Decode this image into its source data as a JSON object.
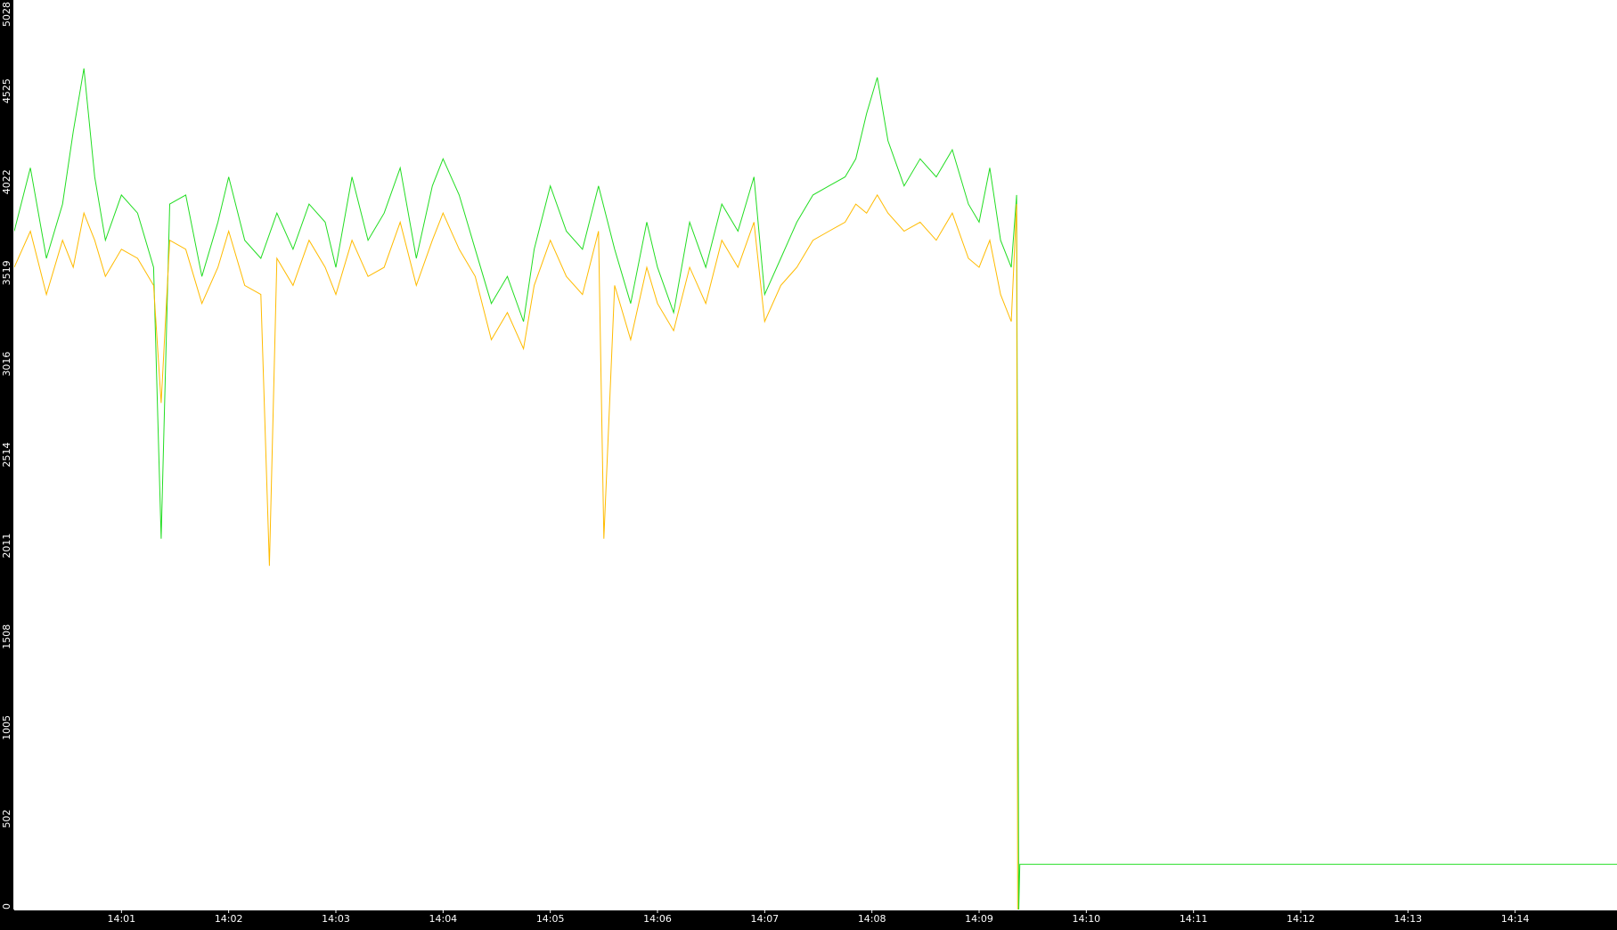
{
  "chart_data": {
    "type": "line",
    "title": "",
    "xlabel": "",
    "ylabel": "",
    "background_color": "#000000",
    "plot_background_color": "#ffffff",
    "axis_color": "#ffffff",
    "grid": false,
    "legend": "none",
    "ylim": [
      0,
      5028
    ],
    "y_ticks": [
      {
        "value": 0,
        "label": "0"
      },
      {
        "value": 502,
        "label": "502"
      },
      {
        "value": 1005,
        "label": "1005"
      },
      {
        "value": 1508,
        "label": "1508"
      },
      {
        "value": 2011,
        "label": "2011"
      },
      {
        "value": 2514,
        "label": "2514"
      },
      {
        "value": 3016,
        "label": "3016"
      },
      {
        "value": 3519,
        "label": "3519"
      },
      {
        "value": 4022,
        "label": "4022"
      },
      {
        "value": 4525,
        "label": "4525"
      },
      {
        "value": 5028,
        "label": "5028"
      }
    ],
    "x_unit": "minutes since 14:00",
    "xlim": [
      0.0,
      14.95
    ],
    "x_ticks": [
      {
        "value": 1,
        "label": "14:01"
      },
      {
        "value": 2,
        "label": "14:02"
      },
      {
        "value": 3,
        "label": "14:03"
      },
      {
        "value": 4,
        "label": "14:04"
      },
      {
        "value": 5,
        "label": "14:05"
      },
      {
        "value": 6,
        "label": "14:06"
      },
      {
        "value": 7,
        "label": "14:07"
      },
      {
        "value": 8,
        "label": "14:08"
      },
      {
        "value": 9,
        "label": "14:09"
      },
      {
        "value": 10,
        "label": "14:10"
      },
      {
        "value": 11,
        "label": "14:11"
      },
      {
        "value": 12,
        "label": "14:12"
      },
      {
        "value": 13,
        "label": "14:13"
      },
      {
        "value": 14,
        "label": "14:14"
      }
    ],
    "series": [
      {
        "color": "#22dd22",
        "x": [
          0.0,
          0.15,
          0.3,
          0.45,
          0.55,
          0.65,
          0.75,
          0.85,
          1.0,
          1.15,
          1.3,
          1.37,
          1.45,
          1.6,
          1.75,
          1.9,
          2.0,
          2.15,
          2.3,
          2.45,
          2.6,
          2.75,
          2.9,
          3.0,
          3.15,
          3.3,
          3.45,
          3.6,
          3.75,
          3.9,
          4.0,
          4.15,
          4.3,
          4.45,
          4.6,
          4.75,
          4.85,
          5.0,
          5.15,
          5.3,
          5.45,
          5.6,
          5.75,
          5.9,
          6.0,
          6.15,
          6.3,
          6.45,
          6.6,
          6.75,
          6.9,
          7.0,
          7.15,
          7.3,
          7.45,
          7.6,
          7.75,
          7.85,
          7.95,
          8.05,
          8.15,
          8.3,
          8.45,
          8.6,
          8.75,
          8.9,
          9.0,
          9.1,
          9.2,
          9.3,
          9.35,
          9.36,
          9.37,
          9.38,
          9.45,
          10.0,
          11.0,
          12.0,
          13.0,
          14.0,
          14.95
        ],
        "values": [
          3750,
          4100,
          3600,
          3900,
          4300,
          4650,
          4050,
          3700,
          3950,
          3850,
          3550,
          2050,
          3900,
          3950,
          3500,
          3800,
          4050,
          3700,
          3600,
          3850,
          3650,
          3900,
          3800,
          3550,
          4050,
          3700,
          3850,
          4100,
          3600,
          4000,
          4150,
          3950,
          3650,
          3350,
          3500,
          3250,
          3650,
          4000,
          3750,
          3650,
          4000,
          3650,
          3350,
          3800,
          3550,
          3300,
          3800,
          3550,
          3900,
          3750,
          4050,
          3400,
          3600,
          3800,
          3950,
          4000,
          4050,
          4150,
          4400,
          4600,
          4250,
          4000,
          4150,
          4050,
          4200,
          3900,
          3800,
          4100,
          3700,
          3550,
          3950,
          2050,
          0,
          250,
          250,
          250,
          250,
          250,
          250,
          250,
          250
        ]
      },
      {
        "color": "#ffbb00",
        "x": [
          0.0,
          0.15,
          0.3,
          0.45,
          0.55,
          0.65,
          0.75,
          0.85,
          1.0,
          1.15,
          1.3,
          1.37,
          1.45,
          1.6,
          1.75,
          1.9,
          2.0,
          2.15,
          2.3,
          2.38,
          2.45,
          2.6,
          2.75,
          2.9,
          3.0,
          3.15,
          3.3,
          3.45,
          3.6,
          3.75,
          3.9,
          4.0,
          4.15,
          4.3,
          4.45,
          4.6,
          4.75,
          4.85,
          5.0,
          5.15,
          5.3,
          5.45,
          5.5,
          5.6,
          5.75,
          5.9,
          6.0,
          6.15,
          6.3,
          6.45,
          6.6,
          6.75,
          6.9,
          7.0,
          7.15,
          7.3,
          7.45,
          7.6,
          7.75,
          7.85,
          7.95,
          8.05,
          8.15,
          8.3,
          8.45,
          8.6,
          8.75,
          8.9,
          9.0,
          9.1,
          9.2,
          9.3,
          9.35,
          9.36
        ],
        "values": [
          3550,
          3750,
          3400,
          3700,
          3550,
          3850,
          3700,
          3500,
          3650,
          3600,
          3450,
          2800,
          3700,
          3650,
          3350,
          3550,
          3750,
          3450,
          3400,
          1900,
          3600,
          3450,
          3700,
          3550,
          3400,
          3700,
          3500,
          3550,
          3800,
          3450,
          3700,
          3850,
          3650,
          3500,
          3150,
          3300,
          3100,
          3450,
          3700,
          3500,
          3400,
          3750,
          2050,
          3450,
          3150,
          3550,
          3350,
          3200,
          3550,
          3350,
          3700,
          3550,
          3800,
          3250,
          3450,
          3550,
          3700,
          3750,
          3800,
          3900,
          3850,
          3950,
          3850,
          3750,
          3800,
          3700,
          3850,
          3600,
          3550,
          3700,
          3400,
          3250,
          3900,
          0
        ]
      }
    ]
  }
}
